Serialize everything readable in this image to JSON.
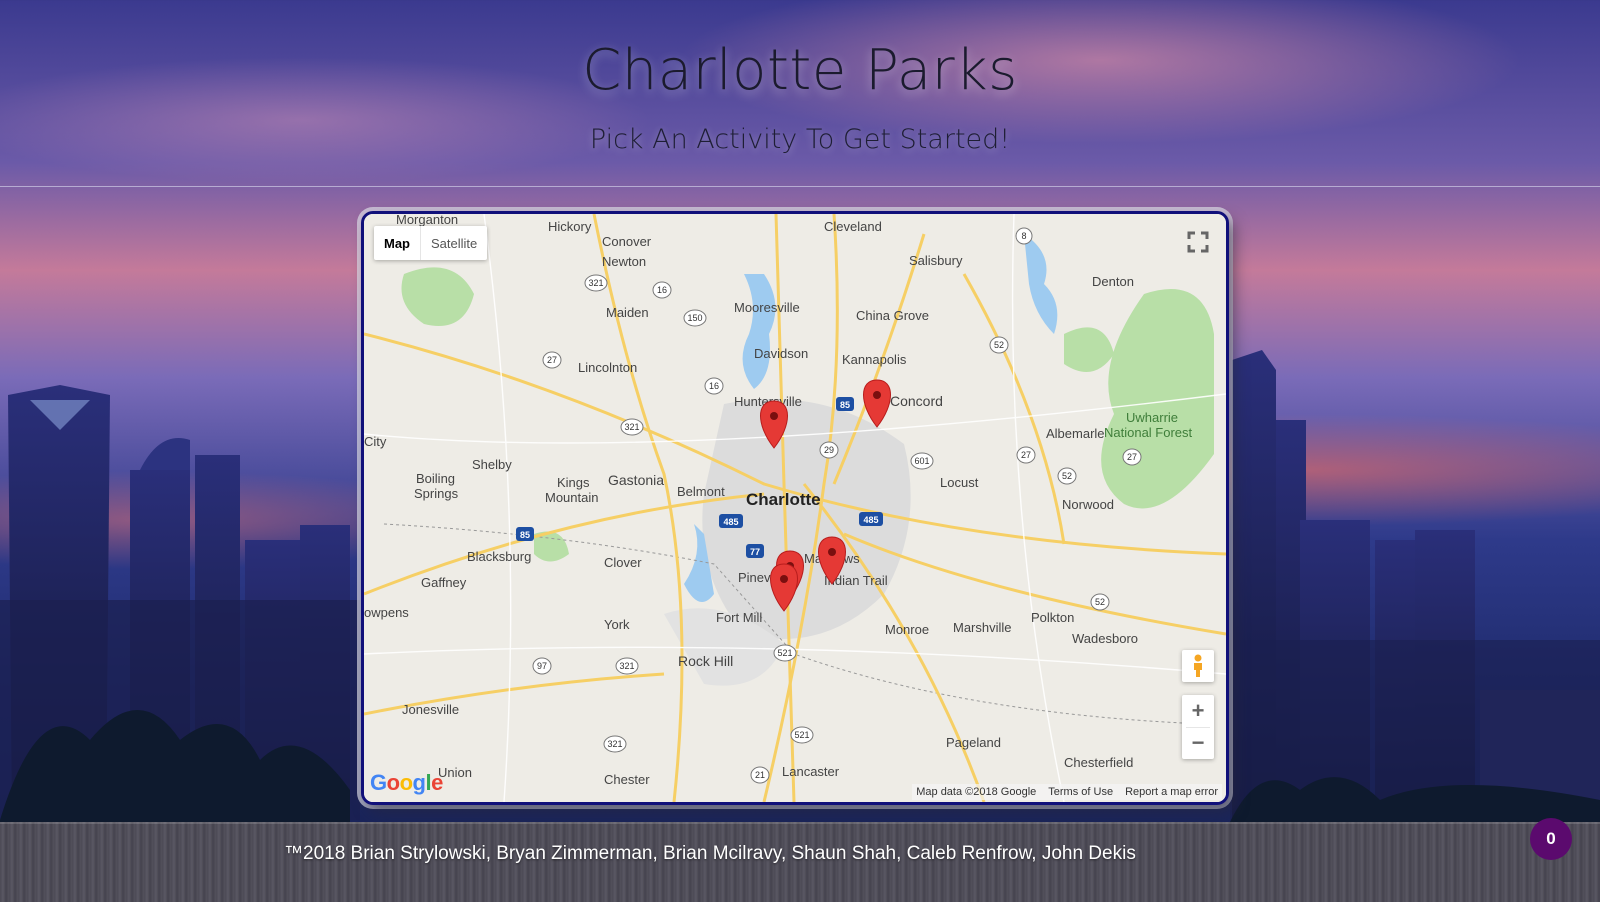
{
  "header": {
    "title": "Charlotte Parks",
    "subtitle": "Pick An Activity To Get Started!"
  },
  "map": {
    "type_controls": {
      "map_label": "Map",
      "satellite_label": "Satellite"
    },
    "fullscreen_icon": "fullscreen-icon",
    "pegman_icon": "street-view-pegman-icon",
    "zoom_in_label": "+",
    "zoom_out_label": "−",
    "logo_text": "Google",
    "attribution": {
      "data": "Map data ©2018 Google",
      "terms": "Terms of Use",
      "report": "Report a map error"
    },
    "marker_color": "#e53935",
    "markers": [
      "Huntersville",
      "Concord",
      "Matthews",
      "Pineville",
      "Pineville"
    ],
    "places": [
      "Morganton",
      "Hickory",
      "Conover",
      "Newton",
      "Cleveland",
      "Salisbury",
      "Denton",
      "Maiden",
      "Mooresville",
      "China Grove",
      "Davidson",
      "Kannapolis",
      "Lincolnton",
      "Huntersville",
      "Concord",
      "Albemarle",
      "Uwharrie",
      "National Forest",
      "City",
      "Shelby",
      "Kings",
      "Mountain",
      "Gastonia",
      "Belmont",
      "Charlotte",
      "Boiling",
      "Springs",
      "Locust",
      "Norwood",
      "Blacksburg",
      "Clover",
      "Matthews",
      "Indian Trail",
      "Gaffney",
      "Pineville",
      "owpens",
      "Fort Mill",
      "York",
      "Monroe",
      "Marshville",
      "Polkton",
      "Wadesboro",
      "Rock Hill",
      "Jonesville",
      "Pageland",
      "Chesterfield",
      "Lancaster",
      "Chester",
      "Union"
    ],
    "route_shields": [
      "321",
      "16",
      "150",
      "27",
      "16",
      "321",
      "85",
      "29",
      "601",
      "52",
      "27",
      "52",
      "85",
      "485",
      "77",
      "485",
      "52",
      "97",
      "321",
      "521",
      "521",
      "321",
      "21",
      "8"
    ]
  },
  "footer": {
    "text": "™2018 Brian Strylowski, Bryan Zimmerman, Brian Mcilravy, Shaun Shah, Caleb Renfrow, John Dekis"
  },
  "badge": {
    "count": "0"
  }
}
